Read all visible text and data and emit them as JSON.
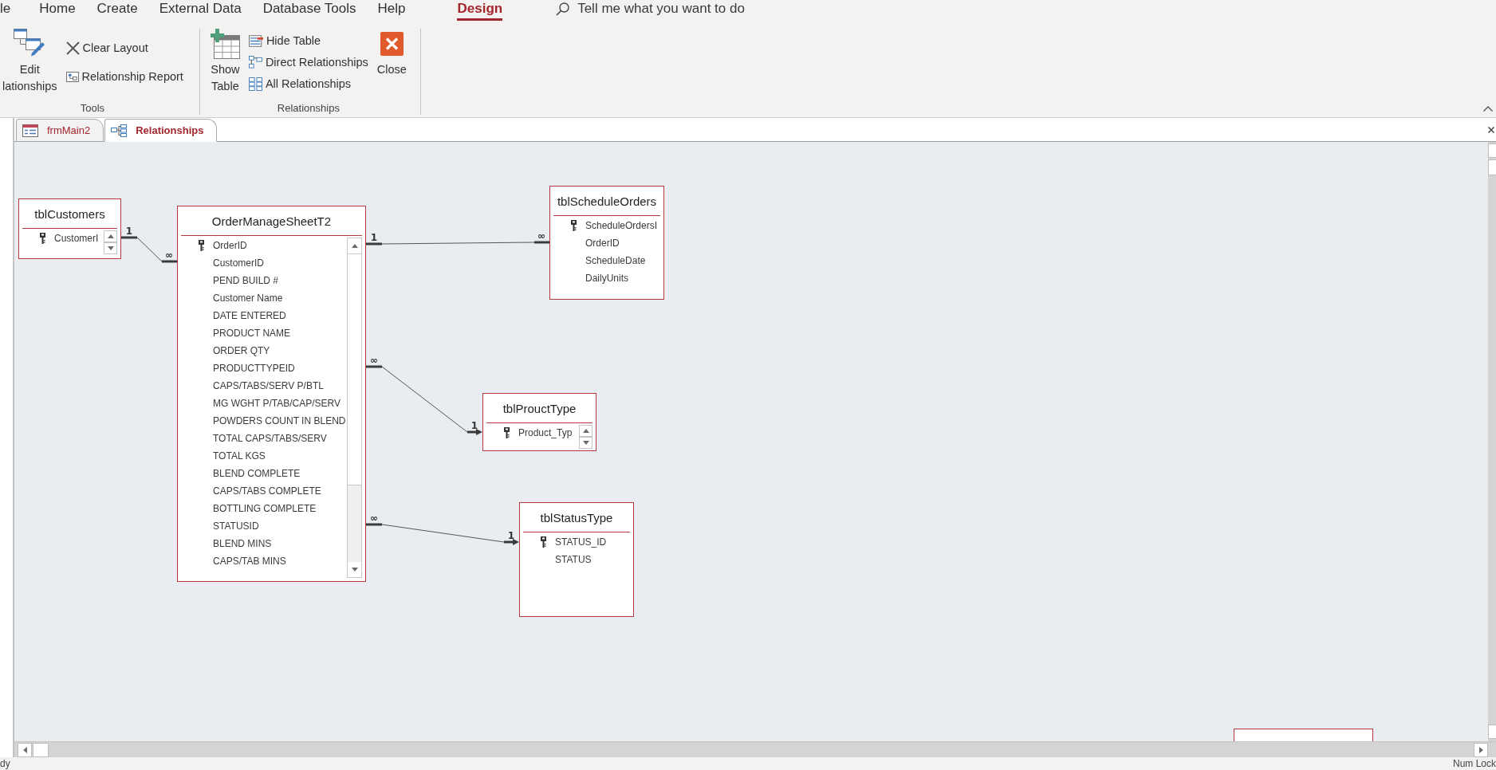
{
  "ribbon_tabs": [
    {
      "label": "le",
      "selected": false
    },
    {
      "label": "Home",
      "selected": false
    },
    {
      "label": "Create",
      "selected": false
    },
    {
      "label": "External Data",
      "selected": false
    },
    {
      "label": "Database Tools",
      "selected": false
    },
    {
      "label": "Help",
      "selected": false
    }
  ],
  "contextual_tabs": [
    {
      "label": "Design",
      "selected": true
    }
  ],
  "tell_me": {
    "placeholder": "Tell me what you want to do"
  },
  "ribbon_groups": [
    {
      "label": "Tools",
      "commands": [
        {
          "kind": "large",
          "lines": [
            "Edit",
            "lationships"
          ]
        },
        {
          "kind": "stack",
          "items": [
            "Clear Layout",
            "Relationship Report"
          ]
        }
      ]
    },
    {
      "label": "Relationships",
      "commands": [
        {
          "kind": "large",
          "lines": [
            "Show",
            "Table"
          ]
        },
        {
          "kind": "stack",
          "items": [
            "Hide Table",
            "Direct Relationships",
            "All Relationships"
          ]
        },
        {
          "kind": "large",
          "lines": [
            "Close"
          ]
        }
      ]
    }
  ],
  "document_tabs": [
    {
      "label": "frmMain2",
      "kind": "form",
      "selected": false
    },
    {
      "label": "Relationships",
      "kind": "relationships",
      "selected": true
    }
  ],
  "tables": [
    {
      "kind": "window",
      "title": "tblCustomers",
      "scrollbar": {
        "kind": "arrows"
      },
      "fields": [
        {
          "name": "CustomerI",
          "key": true
        }
      ]
    },
    {
      "kind": "window",
      "title": "OrderManageSheetT2",
      "scrollbar": {
        "kind": "bar"
      },
      "fields": [
        {
          "name": "OrderID",
          "key": true
        },
        {
          "name": "CustomerID",
          "key": false
        },
        {
          "name": "PEND BUILD #",
          "key": false
        },
        {
          "name": "Customer Name",
          "key": false
        },
        {
          "name": "DATE ENTERED",
          "key": false
        },
        {
          "name": "PRODUCT NAME",
          "key": false
        },
        {
          "name": "ORDER QTY",
          "key": false
        },
        {
          "name": "PRODUCTTYPEID",
          "key": false
        },
        {
          "name": "CAPS/TABS/SERV P/BTL",
          "key": false
        },
        {
          "name": "MG WGHT P/TAB/CAP/SERV",
          "key": false
        },
        {
          "name": "POWDERS COUNT IN BLEND",
          "key": false
        },
        {
          "name": "TOTAL CAPS/TABS/SERV",
          "key": false
        },
        {
          "name": "TOTAL KGS",
          "key": false
        },
        {
          "name": "BLEND COMPLETE",
          "key": false
        },
        {
          "name": "CAPS/TABS COMPLETE",
          "key": false
        },
        {
          "name": "BOTTLING COMPLETE",
          "key": false
        },
        {
          "name": "STATUSID",
          "key": false
        },
        {
          "name": "BLEND MINS",
          "key": false
        },
        {
          "name": "CAPS/TAB MINS",
          "key": false
        }
      ]
    },
    {
      "kind": "window",
      "title": "tblScheduleOrders",
      "fields": [
        {
          "name": "ScheduleOrdersI",
          "key": true
        },
        {
          "name": "OrderID",
          "key": false
        },
        {
          "name": "ScheduleDate",
          "key": false
        },
        {
          "name": "DailyUnits",
          "key": false
        }
      ]
    },
    {
      "kind": "window",
      "title": "tblProuctType",
      "scrollbar": {
        "kind": "arrows"
      },
      "fields": [
        {
          "name": "Product_Typ",
          "key": true
        }
      ]
    },
    {
      "kind": "window",
      "title": "tblStatusType",
      "fields": [
        {
          "name": "STATUS_ID",
          "key": true
        },
        {
          "name": "STATUS",
          "key": false
        }
      ]
    },
    {
      "kind": "cut_off"
    }
  ],
  "relationships": [
    {
      "from_end": "1",
      "to_end": "∞",
      "arrow": false
    },
    {
      "from_end": "1",
      "to_end": "∞",
      "arrow": false
    },
    {
      "from_end": "∞",
      "to_end": "1",
      "arrow": true
    },
    {
      "from_end": "∞",
      "to_end": "1",
      "arrow": true
    }
  ],
  "status_bar": {
    "left": "dy",
    "right": "Num Lock"
  }
}
